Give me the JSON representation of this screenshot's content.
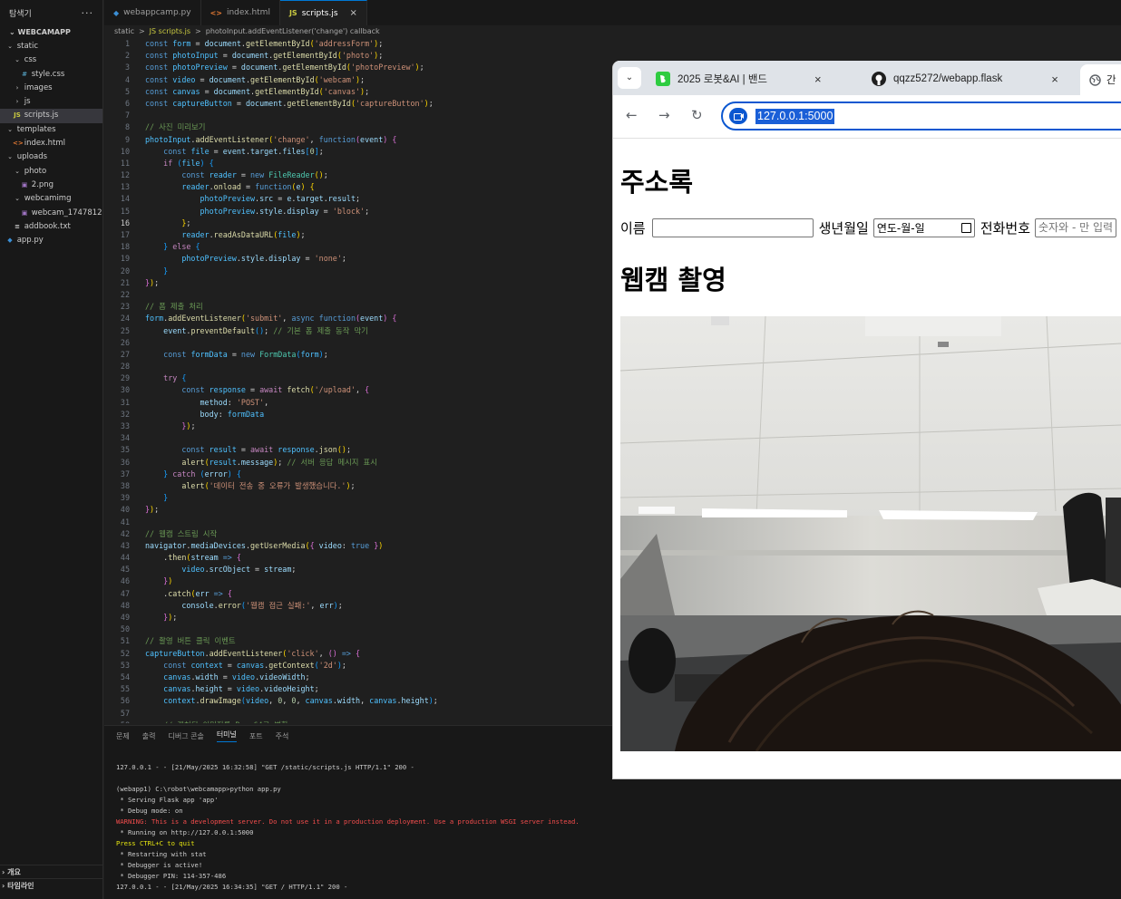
{
  "explorer": {
    "title": "탐색기",
    "more": "···",
    "root": "WEBCAMAPP",
    "items": [
      {
        "label": "static",
        "type": "folder-open"
      },
      {
        "label": "css",
        "type": "folder-open"
      },
      {
        "label": "style.css",
        "type": "css"
      },
      {
        "label": "images",
        "type": "folder"
      },
      {
        "label": "js",
        "type": "folder"
      },
      {
        "label": "scripts.js",
        "type": "js"
      },
      {
        "label": "templates",
        "type": "folder-open"
      },
      {
        "label": "index.html",
        "type": "html"
      },
      {
        "label": "uploads",
        "type": "folder-open"
      },
      {
        "label": "photo",
        "type": "folder-open"
      },
      {
        "label": "2.png",
        "type": "image"
      },
      {
        "label": "webcamimg",
        "type": "folder-open"
      },
      {
        "label": "webcam_17478121...",
        "type": "image"
      },
      {
        "label": "addbook.txt",
        "type": "text"
      },
      {
        "label": "app.py",
        "type": "python"
      }
    ],
    "outline": "개요",
    "timeline": "타임라인"
  },
  "editor_tabs": [
    {
      "label": "webappcamp.py",
      "icon": "python-icon",
      "active": false
    },
    {
      "label": "index.html",
      "icon": "html-icon",
      "active": false
    },
    {
      "label": "scripts.js",
      "icon": "js-icon",
      "active": true
    }
  ],
  "breadcrumb": [
    "static",
    ">",
    "JS scripts.js",
    ">",
    "photoInput.addEventListener('change') callback"
  ],
  "current_line": 16,
  "code_lines": [
    "<span class='kw'>const</span> <span class='cst'>form</span> = <span class='vr'>document</span>.<span class='fn'>getElementById</span><span class='br'>(</span><span class='st'>'addressForm'</span><span class='br'>)</span>;",
    "<span class='kw'>const</span> <span class='cst'>photoInput</span> = <span class='vr'>document</span>.<span class='fn'>getElementById</span><span class='br'>(</span><span class='st'>'photo'</span><span class='br'>)</span>;",
    "<span class='kw'>const</span> <span class='cst'>photoPreview</span> = <span class='vr'>document</span>.<span class='fn'>getElementById</span><span class='br'>(</span><span class='st'>'photoPreview'</span><span class='br'>)</span>;",
    "<span class='kw'>const</span> <span class='cst'>video</span> = <span class='vr'>document</span>.<span class='fn'>getElementById</span><span class='br'>(</span><span class='st'>'webcam'</span><span class='br'>)</span>;",
    "<span class='kw'>const</span> <span class='cst'>canvas</span> = <span class='vr'>document</span>.<span class='fn'>getElementById</span><span class='br'>(</span><span class='st'>'canvas'</span><span class='br'>)</span>;",
    "<span class='kw'>const</span> <span class='cst'>captureButton</span> = <span class='vr'>document</span>.<span class='fn'>getElementById</span><span class='br'>(</span><span class='st'>'captureButton'</span><span class='br'>)</span>;",
    "",
    "<span class='cm'>// 사진 미리보기</span>",
    "<span class='cst'>photoInput</span>.<span class='fn'>addEventListener</span><span class='br'>(</span><span class='st'>'change'</span>, <span class='kw'>function</span><span class='br2'>(</span><span class='vr'>event</span><span class='br2'>)</span> <span class='br2'>{</span>",
    "    <span class='kw'>const</span> <span class='cst'>file</span> = <span class='vr'>event</span>.<span class='vr'>target</span>.<span class='vr'>files</span><span class='br3'>[</span><span class='nm'>0</span><span class='br3'>]</span>;",
    "    <span class='kf'>if</span> <span class='br3'>(</span><span class='cst'>file</span><span class='br3'>)</span> <span class='br3'>{</span>",
    "        <span class='kw'>const</span> <span class='cst'>reader</span> = <span class='kw'>new</span> <span class='cl'>FileReader</span><span class='br'>()</span>;",
    "        <span class='cst'>reader</span>.<span class='fn'>onload</span> = <span class='kw'>function</span><span class='br'>(</span><span class='vr'>e</span><span class='br'>)</span> <span class='br'>{</span>",
    "            <span class='cst'>photoPreview</span>.<span class='vr'>src</span> = <span class='vr'>e</span>.<span class='vr'>target</span>.<span class='vr'>result</span>;",
    "            <span class='cst'>photoPreview</span>.<span class='vr'>style</span>.<span class='vr'>display</span> = <span class='st'>'block'</span>;",
    "        <span class='br'>}</span>;",
    "        <span class='cst'>reader</span>.<span class='fn'>readAsDataURL</span><span class='br'>(</span><span class='cst'>file</span><span class='br'>)</span>;",
    "    <span class='br3'>}</span> <span class='kf'>else</span> <span class='br3'>{</span>",
    "        <span class='cst'>photoPreview</span>.<span class='vr'>style</span>.<span class='vr'>display</span> = <span class='st'>'none'</span>;",
    "    <span class='br3'>}</span>",
    "<span class='br2'>}</span><span class='br'>)</span>;",
    "",
    "<span class='cm'>// 폼 제출 처리</span>",
    "<span class='cst'>form</span>.<span class='fn'>addEventListener</span><span class='br'>(</span><span class='st'>'submit'</span>, <span class='kw'>async</span> <span class='kw'>function</span><span class='br2'>(</span><span class='vr'>event</span><span class='br2'>)</span> <span class='br2'>{</span>",
    "    <span class='vr'>event</span>.<span class='fn'>preventDefault</span><span class='br3'>()</span>; <span class='cm'>// 기본 폼 제출 동작 막기</span>",
    "",
    "    <span class='kw'>const</span> <span class='cst'>formData</span> = <span class='kw'>new</span> <span class='cl'>FormData</span><span class='br3'>(</span><span class='cst'>form</span><span class='br3'>)</span>;",
    "",
    "    <span class='kf'>try</span> <span class='br3'>{</span>",
    "        <span class='kw'>const</span> <span class='cst'>response</span> = <span class='kf'>await</span> <span class='fn'>fetch</span><span class='br'>(</span><span class='st'>'/upload'</span>, <span class='br2'>{</span>",
    "            <span class='vr'>method</span>: <span class='st'>'POST'</span>,",
    "            <span class='vr'>body</span>: <span class='cst'>formData</span>",
    "        <span class='br2'>}</span><span class='br'>)</span>;",
    "",
    "        <span class='kw'>const</span> <span class='cst'>result</span> = <span class='kf'>await</span> <span class='cst'>response</span>.<span class='fn'>json</span><span class='br'>()</span>;",
    "        <span class='fn'>alert</span><span class='br'>(</span><span class='cst'>result</span>.<span class='vr'>message</span><span class='br'>)</span>; <span class='cm'>// 서버 응답 메시지 표시</span>",
    "    <span class='br3'>}</span> <span class='kf'>catch</span> <span class='br3'>(</span><span class='vr'>error</span><span class='br3'>)</span> <span class='br3'>{</span>",
    "        <span class='fn'>alert</span><span class='br'>(</span><span class='st'>'데이터 전송 중 오류가 발생했습니다.'</span><span class='br'>)</span>;",
    "    <span class='br3'>}</span>",
    "<span class='br2'>}</span><span class='br'>)</span>;",
    "",
    "<span class='cm'>// 웹캠 스트림 시작</span>",
    "<span class='vr'>navigator</span>.<span class='vr'>mediaDevices</span>.<span class='fn'>getUserMedia</span><span class='br'>(</span><span class='br2'>{</span> <span class='vr'>video</span>: <span class='kw'>true</span> <span class='br2'>}</span><span class='br'>)</span>",
    "    .<span class='fn'>then</span><span class='br'>(</span><span class='vr'>stream</span> <span class='kw'>=&gt;</span> <span class='br2'>{</span>",
    "        <span class='cst'>video</span>.<span class='vr'>srcObject</span> = <span class='vr'>stream</span>;",
    "    <span class='br2'>}</span><span class='br'>)</span>",
    "    .<span class='fn'>catch</span><span class='br'>(</span><span class='vr'>err</span> <span class='kw'>=&gt;</span> <span class='br2'>{</span>",
    "        <span class='vr'>console</span>.<span class='fn'>error</span><span class='br3'>(</span><span class='st'>'웹캠 접근 실패:'</span>, <span class='vr'>err</span><span class='br3'>)</span>;",
    "    <span class='br2'>}</span><span class='br'>)</span>;",
    "",
    "<span class='cm'>// 촬영 버튼 클릭 이벤트</span>",
    "<span class='cst'>captureButton</span>.<span class='fn'>addEventListener</span><span class='br'>(</span><span class='st'>'click'</span>, <span class='br2'>()</span> <span class='kw'>=&gt;</span> <span class='br2'>{</span>",
    "    <span class='kw'>const</span> <span class='cst'>context</span> = <span class='cst'>canvas</span>.<span class='fn'>getContext</span><span class='br3'>(</span><span class='st'>'2d'</span><span class='br3'>)</span>;",
    "    <span class='cst'>canvas</span>.<span class='vr'>width</span> = <span class='cst'>video</span>.<span class='vr'>videoWidth</span>;",
    "    <span class='cst'>canvas</span>.<span class='vr'>height</span> = <span class='cst'>video</span>.<span class='vr'>videoHeight</span>;",
    "    <span class='cst'>context</span>.<span class='fn'>drawImage</span><span class='br3'>(</span><span class='cst'>video</span>, <span class='nm'>0</span>, <span class='nm'>0</span>, <span class='cst'>canvas</span>.<span class='vr'>width</span>, <span class='cst'>canvas</span>.<span class='vr'>height</span><span class='br3'>)</span>;",
    "",
    "    <span class='cm'>// 캡처된 이미지를 Base64로 변환</span>"
  ],
  "panel_tabs": [
    {
      "label": "문제",
      "active": false
    },
    {
      "label": "출력",
      "active": false
    },
    {
      "label": "디버그 콘솔",
      "active": false
    },
    {
      "label": "터미널",
      "active": true
    },
    {
      "label": "포트",
      "active": false
    },
    {
      "label": "주석",
      "active": false
    }
  ],
  "terminal_lines": [
    {
      "text": "127.0.0.1 - - [21/May/2025 16:32:58] \"GET /static/scripts.js HTTP/1.1\" 200 -",
      "kind": "normal"
    },
    {
      "text": "",
      "kind": "normal"
    },
    {
      "text": "(webapp1) C:\\robot\\webcamapp>python app.py",
      "kind": "normal"
    },
    {
      "text": " * Serving Flask app 'app'",
      "kind": "normal"
    },
    {
      "text": " * Debug mode: on",
      "kind": "normal"
    },
    {
      "text": "WARNING: This is a development server. Do not use it in a production deployment. Use a production WSGI server instead.",
      "kind": "warn"
    },
    {
      "text": " * Running on http://127.0.0.1:5000",
      "kind": "normal"
    },
    {
      "text": "Press CTRL+C to quit",
      "kind": "yellow"
    },
    {
      "text": " * Restarting with stat",
      "kind": "normal"
    },
    {
      "text": " * Debugger is active!",
      "kind": "normal"
    },
    {
      "text": " * Debugger PIN: 114-357-486",
      "kind": "normal"
    },
    {
      "text": "127.0.0.1 - - [21/May/2025 16:34:35] \"GET / HTTP/1.1\" 200 -",
      "kind": "normal"
    }
  ],
  "browser": {
    "tabs": [
      {
        "label": "2025 로봇&AI | 밴드",
        "close": "×"
      },
      {
        "label": "qqzz5272/webapp.flask",
        "close": "×"
      }
    ],
    "active_tab_label": "간",
    "url": "127.0.0.1:5000",
    "page": {
      "heading_address": "주소록",
      "name_label": "이름",
      "name_value": "",
      "birth_label": "생년월일",
      "birth_placeholder": "연도-월-일",
      "phone_label": "전화번호",
      "phone_placeholder": "숫자와 - 만 입력",
      "heading_webcam": "웹캠 촬영"
    }
  }
}
